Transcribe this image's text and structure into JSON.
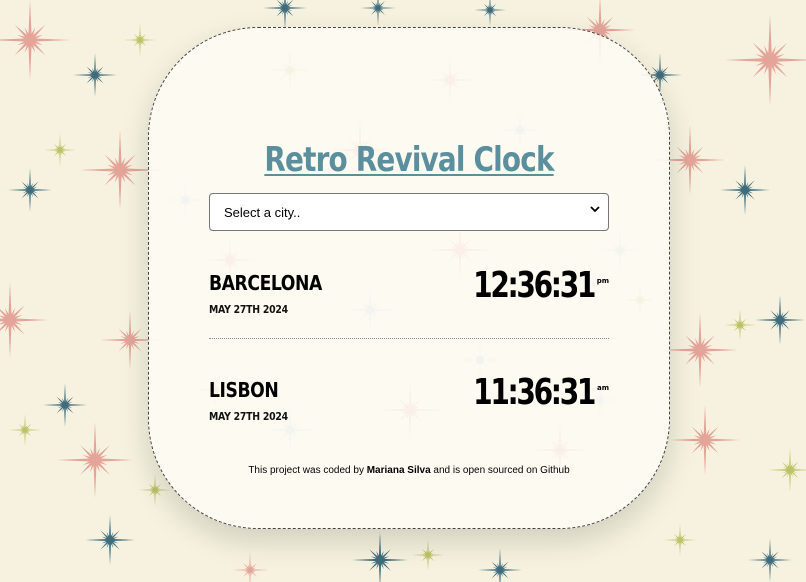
{
  "app": {
    "title": "Retro Revival Clock"
  },
  "city_select": {
    "selected_label": "Select a city.."
  },
  "cities": [
    {
      "name": "Barcelona",
      "date": "May 27th 2024",
      "time": "12:36:31",
      "ampm": "pm"
    },
    {
      "name": "Lisbon",
      "date": "May 27th 2024",
      "time": "11:36:31",
      "ampm": "am"
    }
  ],
  "footer": {
    "prefix": "This project was coded by ",
    "author": "Mariana Silva",
    "middle": " and is ",
    "open_sourced": "open sourced",
    "suffix": " on Github"
  },
  "colors": {
    "background": "#f6f2df",
    "title": "#5b8f9d",
    "star_teal": "#3f6c7c",
    "star_pink": "#e4a49a",
    "star_olive": "#bcc266",
    "star_blue": "#a8c4d4"
  }
}
